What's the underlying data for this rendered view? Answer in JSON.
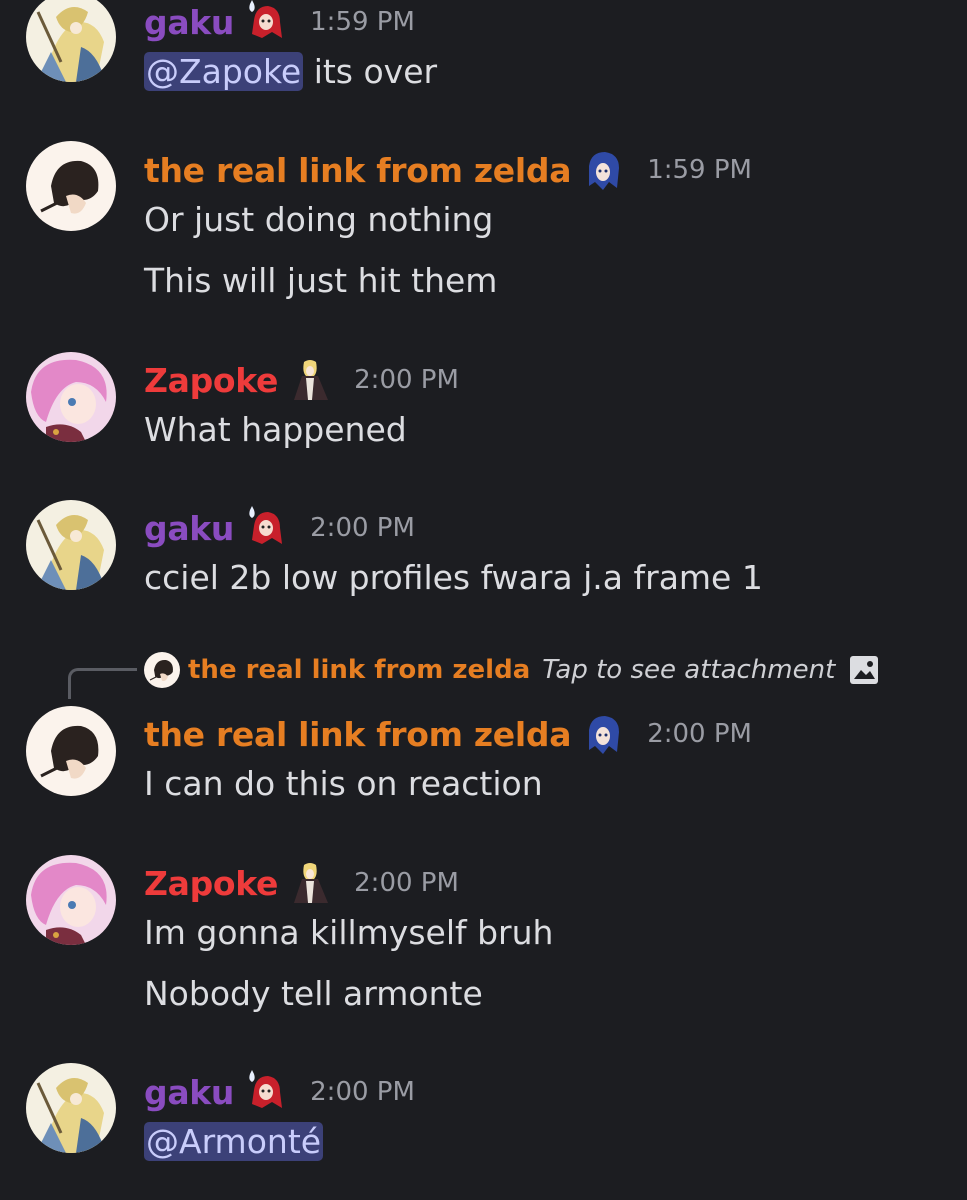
{
  "messages": [
    {
      "user": "gaku",
      "timestamp": "1:59 PM",
      "avatar": "avatar-blonde-elf-icon",
      "decoration": "red-hair-girl-icon",
      "lines": [
        {
          "mention": "@Zapoke",
          "text": " its over"
        }
      ]
    },
    {
      "user": "the real link from zelda",
      "timestamp": "1:59 PM",
      "avatar": "avatar-dark-hair-icon",
      "decoration": "blue-hair-girl-icon",
      "lines": [
        {
          "text": "Or just doing nothing"
        },
        {
          "text": "This will just hit them"
        }
      ]
    },
    {
      "user": "Zapoke",
      "timestamp": "2:00 PM",
      "avatar": "avatar-pink-hair-icon",
      "decoration": "blonde-caped-figure-icon",
      "lines": [
        {
          "text": "What happened"
        }
      ]
    },
    {
      "user": "gaku",
      "timestamp": "2:00 PM",
      "avatar": "avatar-blonde-elf-icon",
      "decoration": "red-hair-girl-icon",
      "lines": [
        {
          "text": "cciel 2b low profiles fwara j.a frame 1"
        }
      ]
    },
    {
      "reply": {
        "user": "the real link from zelda",
        "text": "Tap to see attachment",
        "icon": "image-attachment-icon"
      },
      "user": "the real link from zelda",
      "timestamp": "2:00 PM",
      "avatar": "avatar-dark-hair-icon",
      "decoration": "blue-hair-girl-icon",
      "lines": [
        {
          "text": "I can do this on reaction"
        }
      ]
    },
    {
      "user": "Zapoke",
      "timestamp": "2:00 PM",
      "avatar": "avatar-pink-hair-icon",
      "decoration": "blonde-caped-figure-icon",
      "lines": [
        {
          "text": "Im gonna killmyself bruh"
        },
        {
          "text": "Nobody tell armonte"
        }
      ]
    },
    {
      "user": "gaku",
      "timestamp": "2:00 PM",
      "avatar": "avatar-blonde-elf-icon",
      "decoration": "red-hair-girl-icon",
      "lines": [
        {
          "mention": "@Armonté",
          "text": ""
        }
      ]
    }
  ],
  "colors": {
    "background": "#1c1d21",
    "gaku": "#8a4cc0",
    "link": "#e67e22",
    "zapoke": "#ee3b3b",
    "mention_bg": "#3c4178",
    "mention_text": "#c9cdfb",
    "timestamp": "#9a9ca4",
    "message_text": "#dcdde1"
  }
}
